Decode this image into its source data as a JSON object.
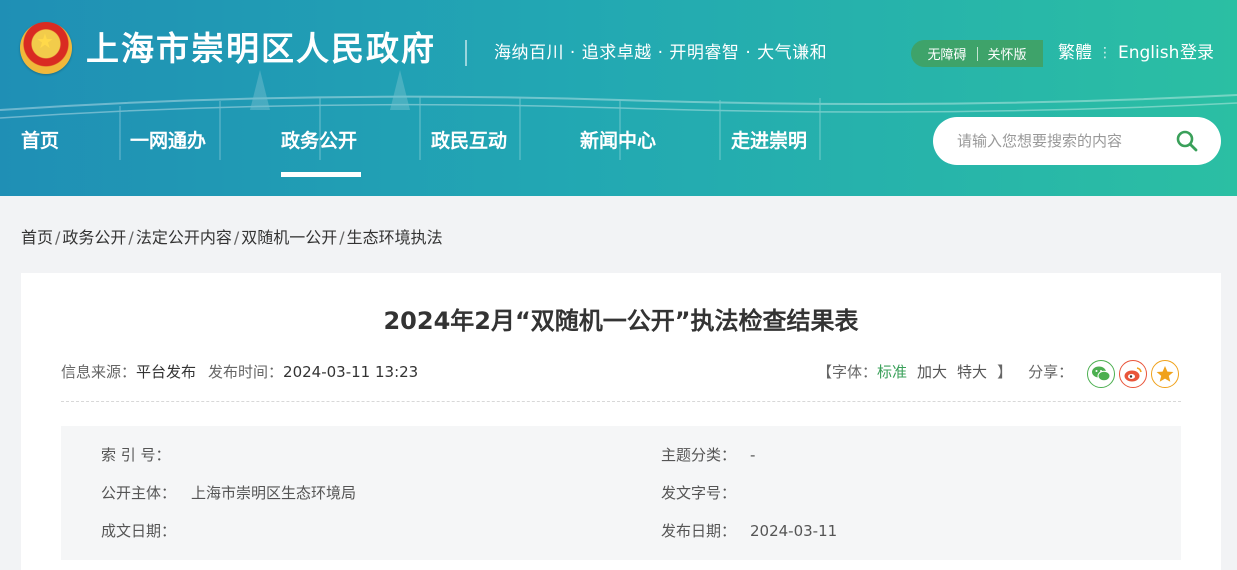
{
  "header": {
    "site_title": "上海市崇明区人民政府",
    "slogan": "海纳百川 · 追求卓越 · 开明睿智 · 大气谦和",
    "accessibility": "无障碍",
    "elder_mode": "关怀版",
    "traditional": "繁體",
    "english": "English",
    "login": "登录",
    "emblem_icon": "national-emblem-icon"
  },
  "nav": {
    "items": [
      {
        "label": "首页"
      },
      {
        "label": "一网通办"
      },
      {
        "label": "政务公开",
        "active": true
      },
      {
        "label": "政民互动"
      },
      {
        "label": "新闻中心"
      },
      {
        "label": "走进崇明"
      }
    ]
  },
  "search": {
    "placeholder": "请输入您想要搜索的内容",
    "icon": "search-icon"
  },
  "breadcrumb": [
    "首页",
    "政务公开",
    "法定公开内容",
    "双随机一公开",
    "生态环境执法"
  ],
  "article": {
    "title": "2024年2月“双随机一公开”执法检查结果表",
    "source_label": "信息来源：",
    "source_value": "平台发布",
    "time_label": "发布时间：",
    "time_value": "2024-03-11 13:23",
    "font_label": "【字体：",
    "font_standard": "标准",
    "font_large": "加大",
    "font_xlarge": "特大",
    "font_close": "】",
    "share_label": "分享：",
    "share_icons": [
      "wechat-icon",
      "weibo-icon",
      "favorite-star-icon"
    ]
  },
  "info": {
    "index_label": "索  引  号：",
    "index_value": "",
    "topic_label": "主题分类：",
    "topic_value": "-",
    "publisher_label": "公开主体：",
    "publisher_value": "上海市崇明区生态环境局",
    "docno_label": "发文字号：",
    "docno_value": "",
    "created_label": "成文日期：",
    "created_value": "",
    "published_label": "发布日期：",
    "published_value": "2024-03-11"
  },
  "colors": {
    "header_start": "#1f8fb5",
    "header_end": "#2bbfa3",
    "accent_green": "#3aa05a",
    "accessibility_bg": "#3ea36a"
  }
}
